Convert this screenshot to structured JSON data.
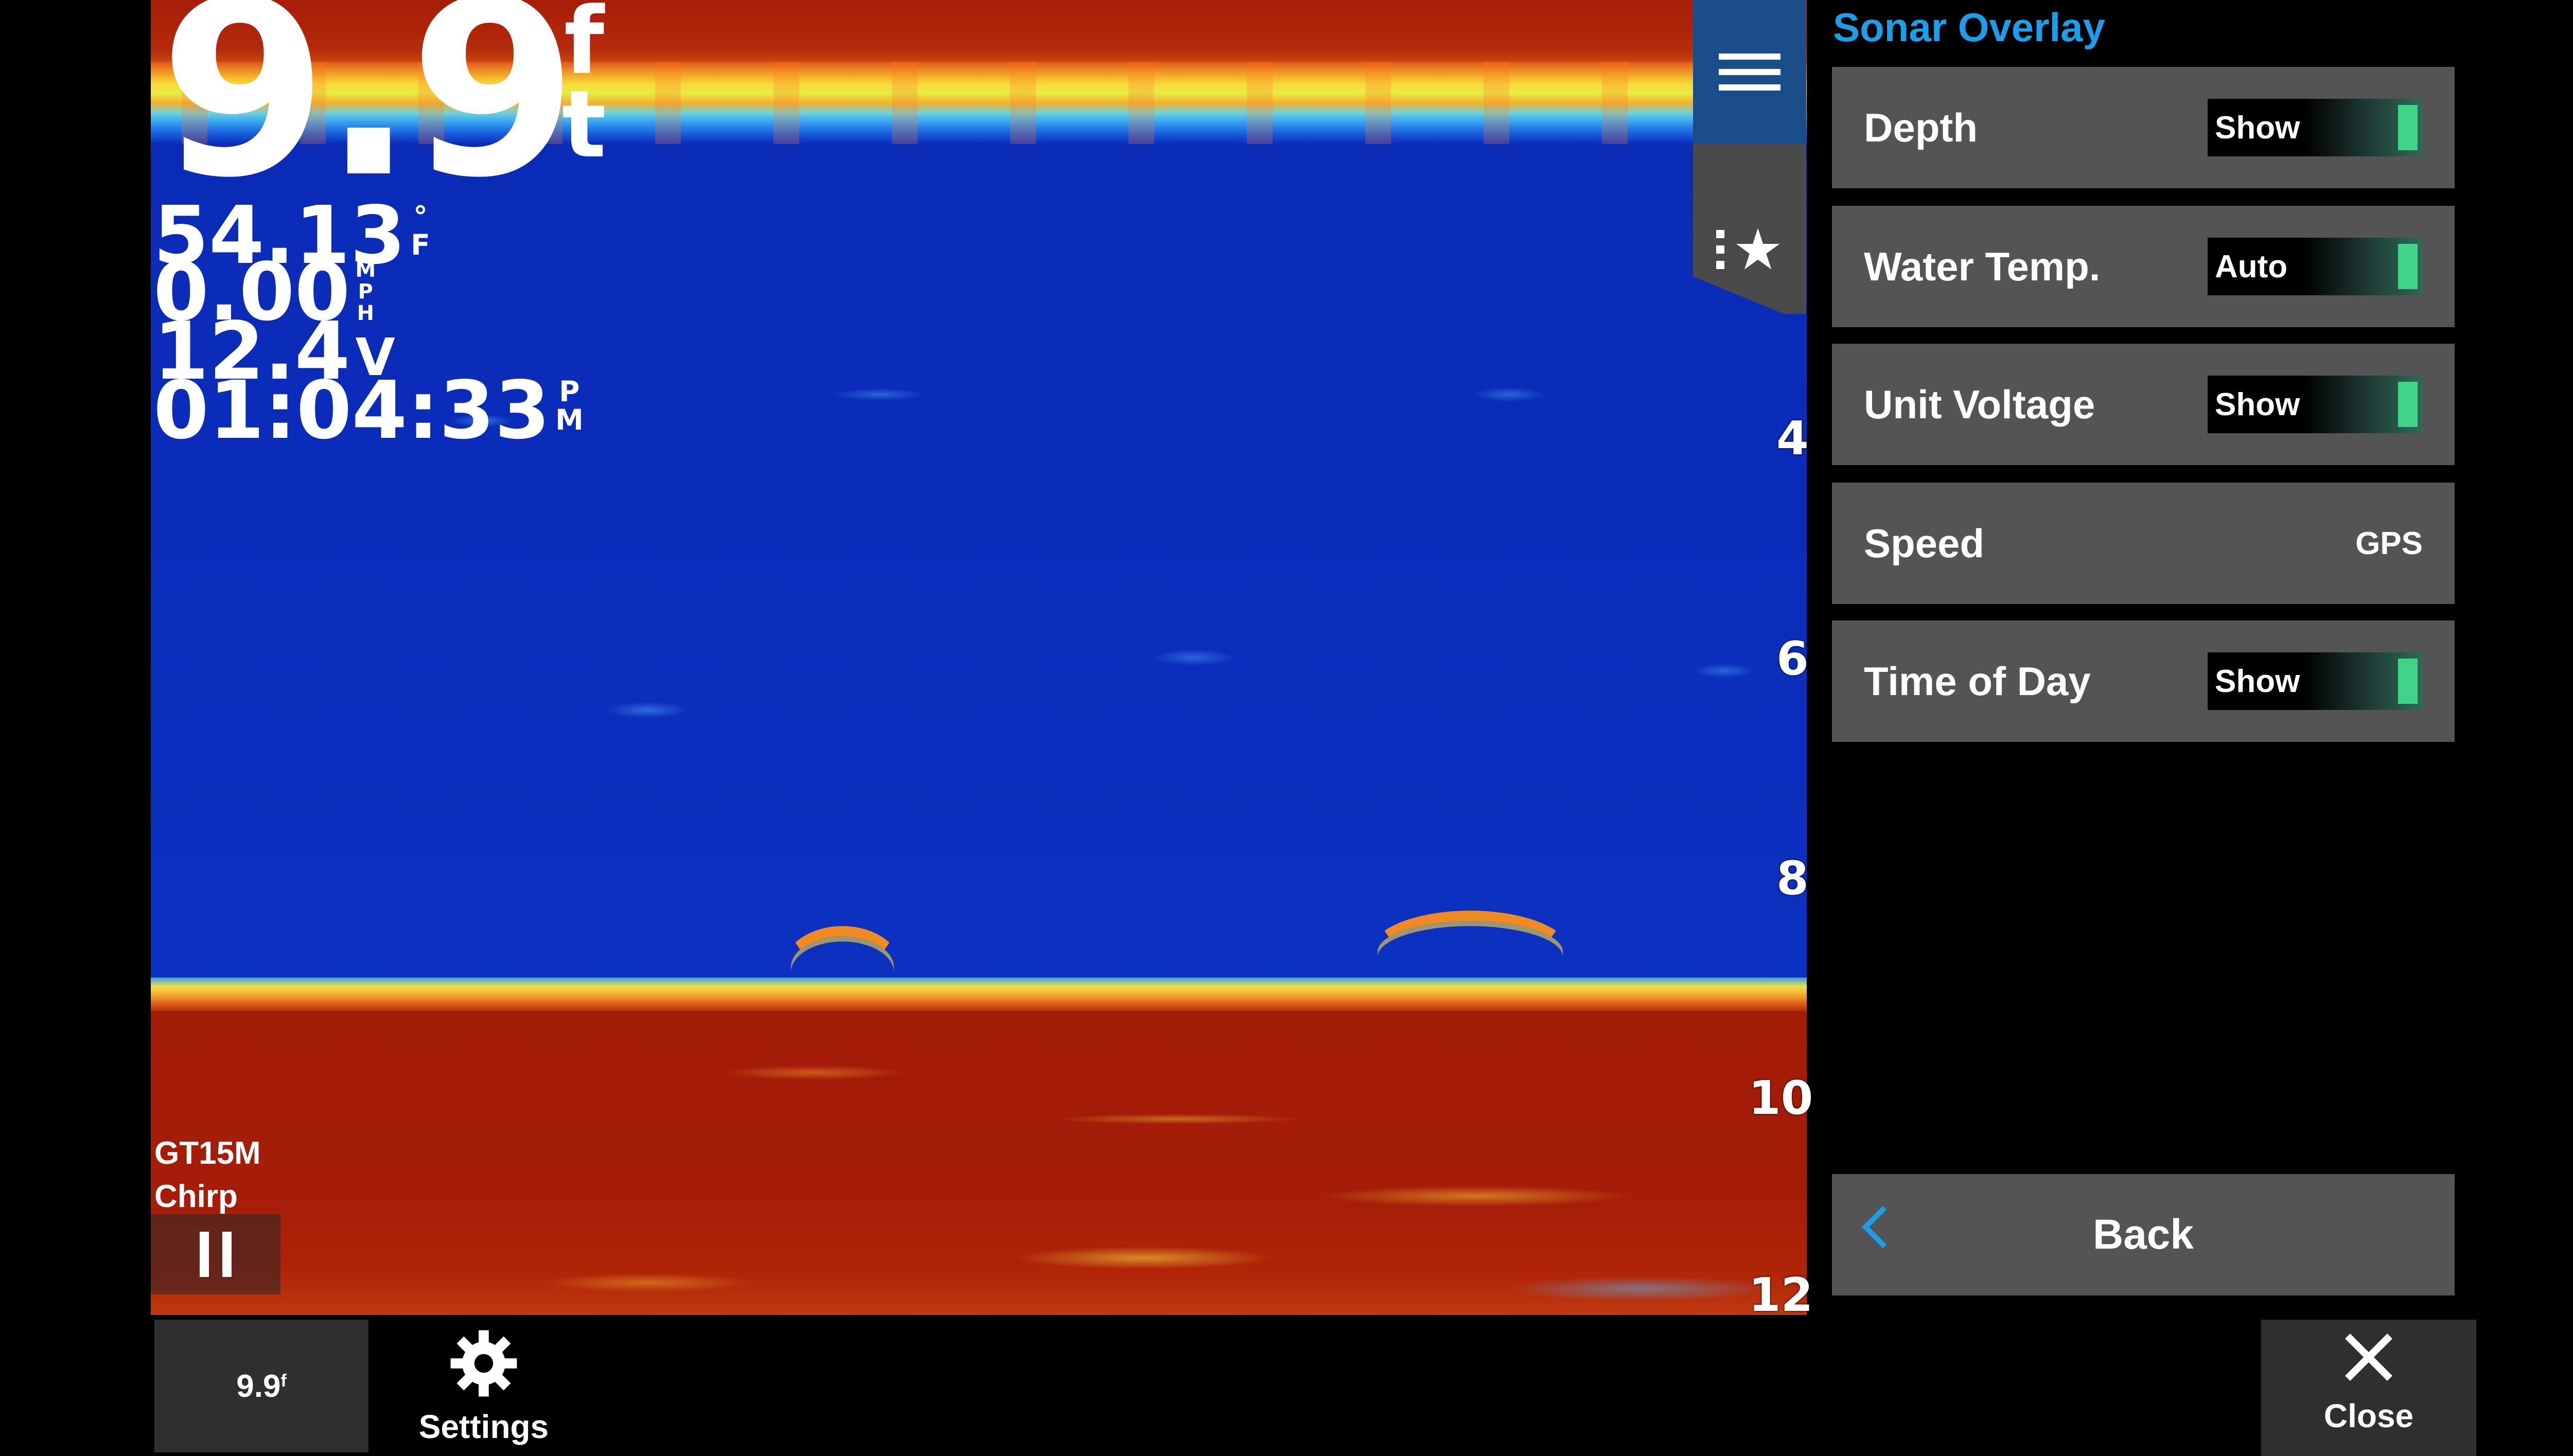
{
  "sonar": {
    "depth_value": "9.9",
    "depth_unit_top": "f",
    "depth_unit_bottom": "t",
    "water_temp": "54.13",
    "water_temp_unit_top": "°",
    "water_temp_unit_bottom": "F",
    "speed": "0.00",
    "speed_unit_top": "M",
    "speed_unit_mid": "P",
    "speed_unit_bottom": "H",
    "voltage": "12.4",
    "voltage_unit": "V",
    "time": "01:04:33",
    "time_unit_top": "P",
    "time_unit_bottom": "M",
    "depth_scale": [
      "4",
      "6",
      "8",
      "10",
      "12"
    ],
    "transducer_model": "GT15M",
    "transducer_mode": "Chirp"
  },
  "side_tabs": {
    "menu_icon": "hamburger-menu-icon",
    "favorites_icon": "favorites-star-list-icon"
  },
  "overlay_menu": {
    "title": "Sonar Overlay",
    "items": [
      {
        "label": "Depth",
        "value": "Show",
        "control": "toggle"
      },
      {
        "label": "Water Temp.",
        "value": "Auto",
        "control": "toggle"
      },
      {
        "label": "Unit Voltage",
        "value": "Show",
        "control": "toggle"
      },
      {
        "label": "Speed",
        "value": "GPS",
        "control": "text"
      },
      {
        "label": "Time of Day",
        "value": "Show",
        "control": "toggle"
      }
    ],
    "back_label": "Back"
  },
  "bottom_bar": {
    "depth_chip": "9.9",
    "depth_chip_unit": "f",
    "settings_label": "Settings",
    "close_label": "Close"
  },
  "colors": {
    "accent_blue": "#1aa0ea",
    "menu_item_bg": "#545454",
    "toggle_knob": "#3fd48a",
    "water_blue": "#0b2cbb",
    "bottom_red": "#a51d08"
  }
}
